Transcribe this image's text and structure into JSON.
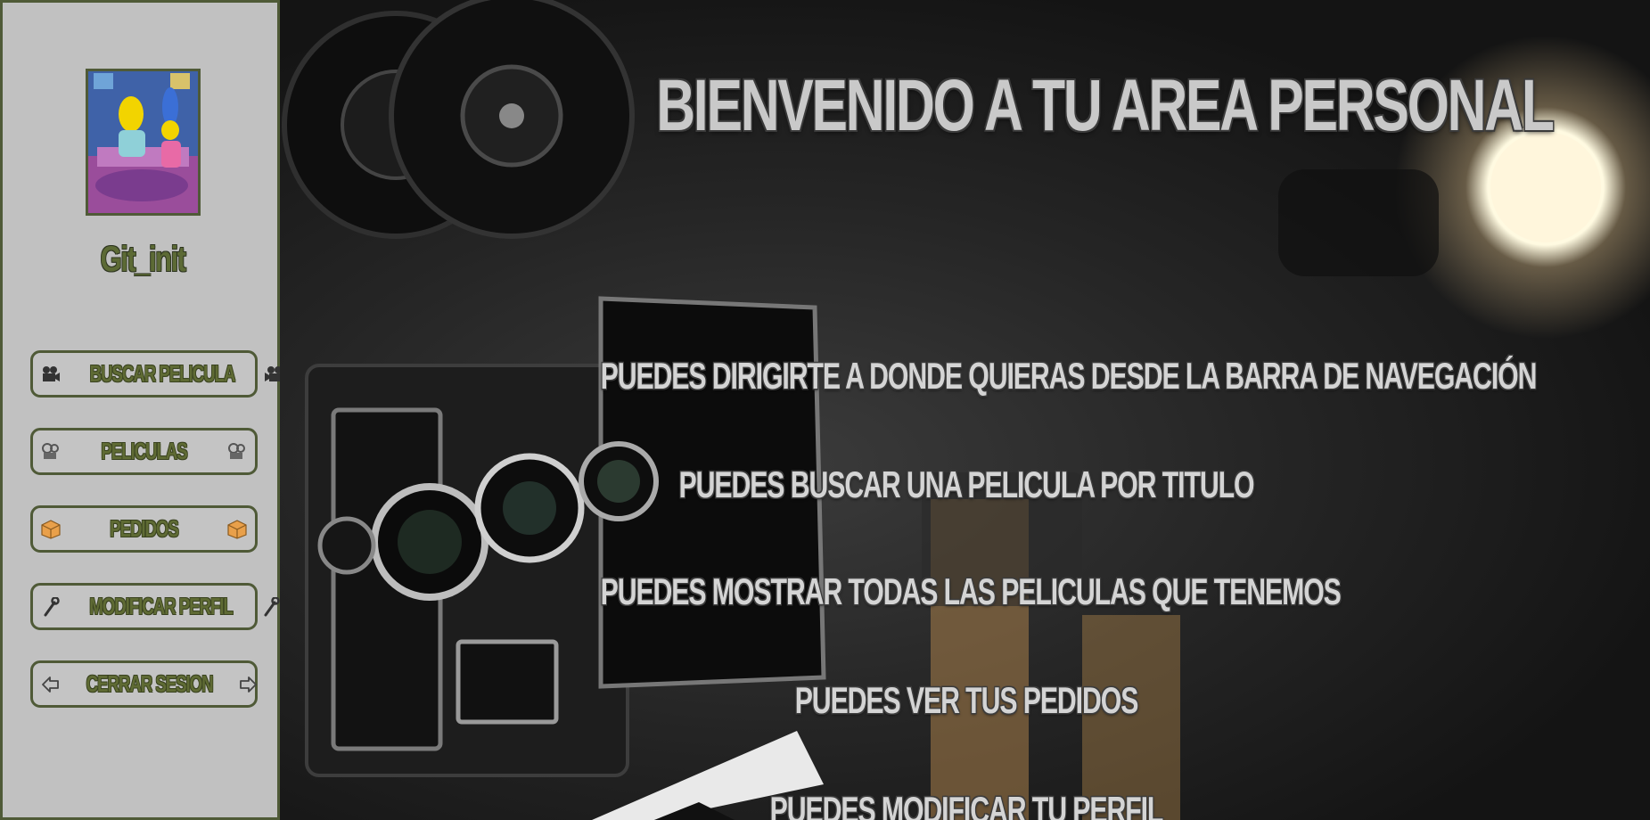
{
  "sidebar": {
    "username": "Git_init",
    "avatar_icon": "family-cartoon-avatar",
    "buttons": [
      {
        "label": "BUSCAR PELICULA",
        "icon": "film-camera-icon"
      },
      {
        "label": "PELICULAS",
        "icon": "film-projector-icon"
      },
      {
        "label": "PEDIDOS",
        "icon": "package-icon"
      },
      {
        "label": "MODIFICAR PERFIL",
        "icon": "wrench-icon"
      },
      {
        "label": "CERRAR SESION",
        "icon": "exit-arrow-icon"
      }
    ]
  },
  "main": {
    "title": "BIENVENIDO A TU AREA PERSONAL",
    "lines": [
      "PUEDES DIRIGIRTE A DONDE QUIERAS DESDE LA BARRA DE NAVEGACIÓN",
      "PUEDES BUSCAR UNA PELICULA POR TITULO",
      "PUEDES MOSTRAR TODAS LAS PELICULAS QUE TENEMOS",
      "PUEDES VER TUS PEDIDOS",
      "PUEDES MODIFICAR TU PERFIL"
    ]
  },
  "colors": {
    "sidebar_bg": "#c1c1c1",
    "accent": "#4f5a37",
    "label": "#5f6b34",
    "heading": "#c9c9c9"
  }
}
